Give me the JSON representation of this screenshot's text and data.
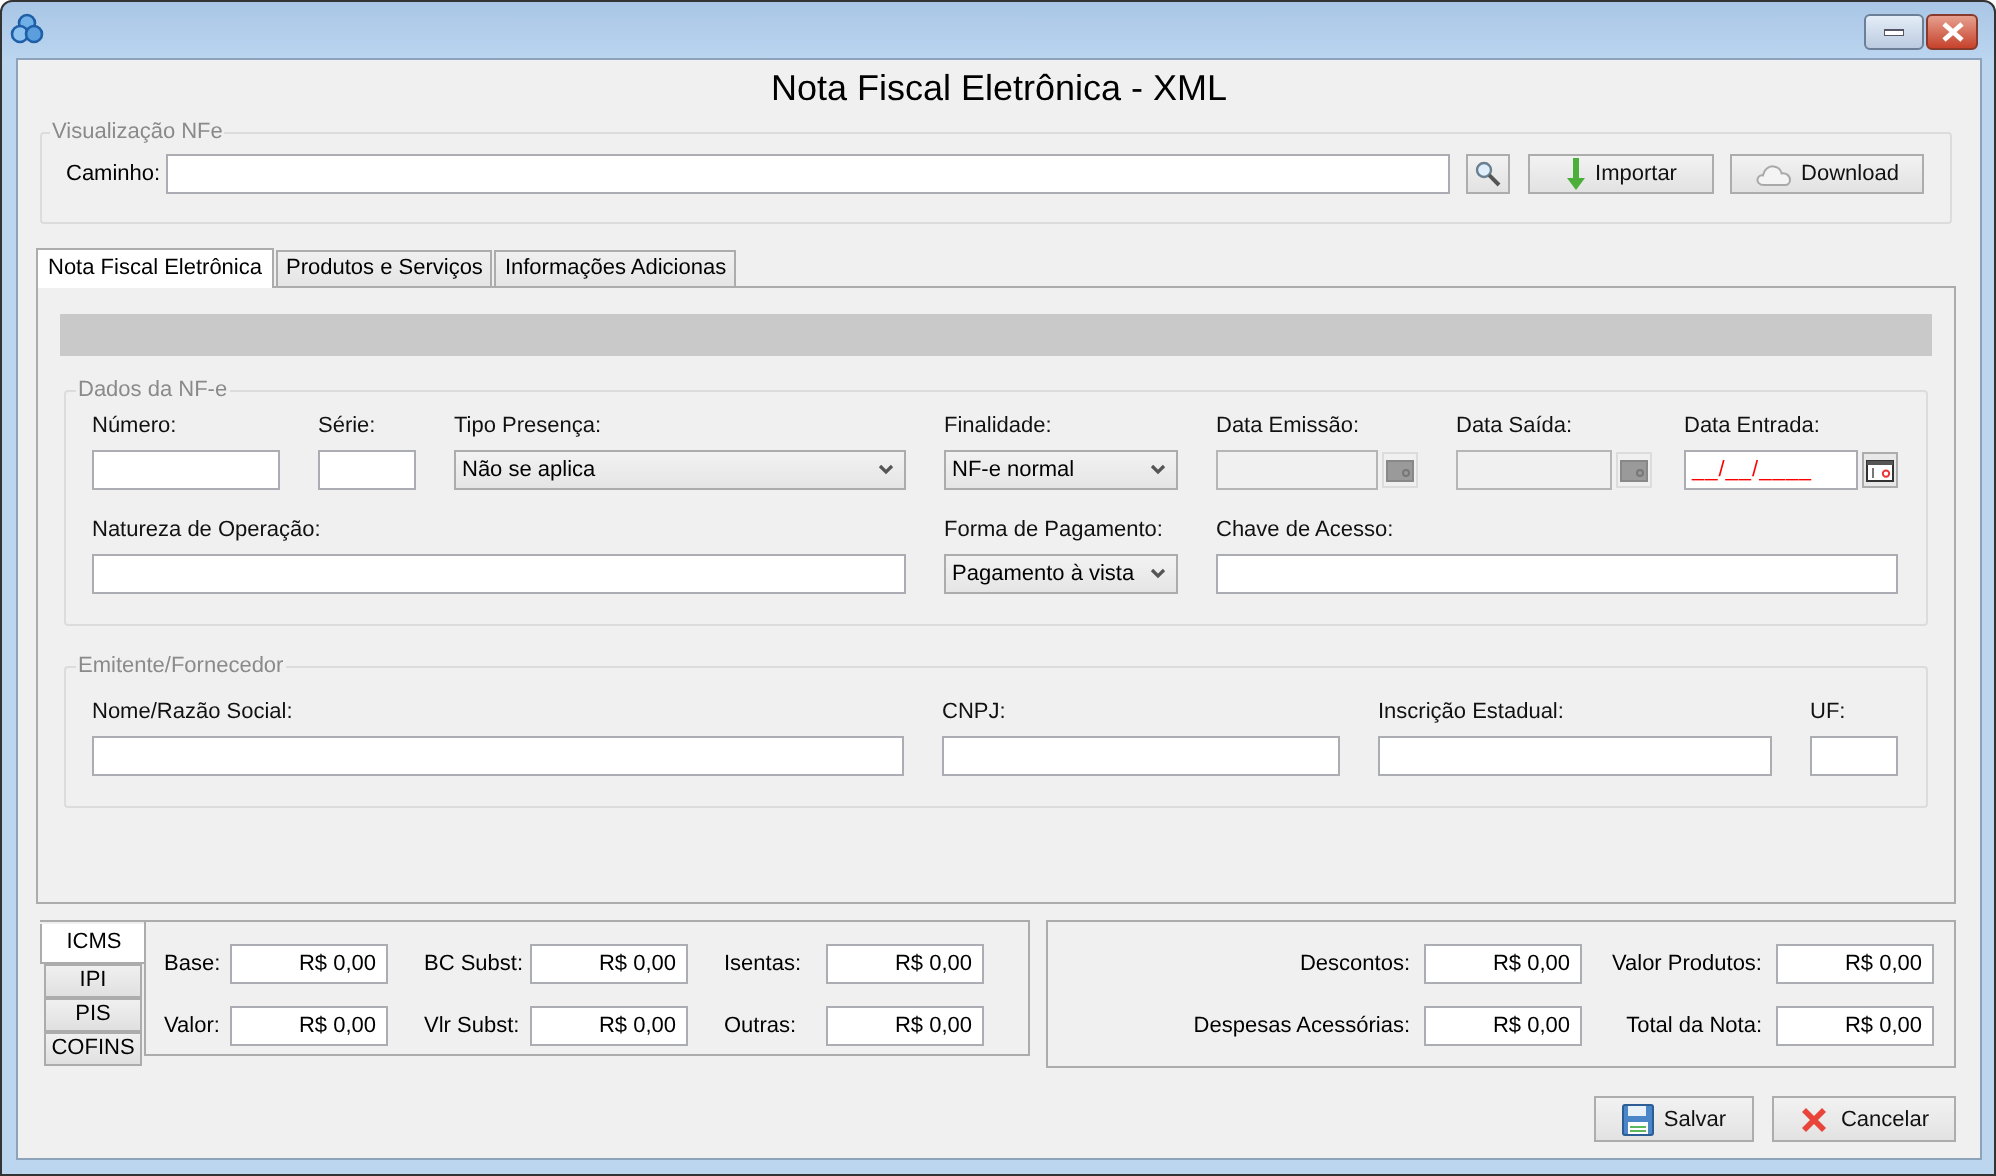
{
  "window": {
    "title": "Nota Fiscal Eletrônica - XML"
  },
  "visualizacao": {
    "legend": "Visualização NFe",
    "path_label": "Caminho:",
    "buttons": [
      {
        "kind": "search"
      },
      {
        "kind": "import",
        "label": "Importar"
      },
      {
        "kind": "download",
        "label": "Download"
      }
    ]
  },
  "tabs": [
    {
      "label": "Nota Fiscal Eletrônica",
      "selected": true
    },
    {
      "label": "Produtos e Serviços",
      "selected": false
    },
    {
      "label": "Informações Adicionas",
      "selected": false
    }
  ],
  "dados_nfe": {
    "legend": "Dados da NF-e",
    "fields": [
      {
        "kind": "text",
        "label": "Número:",
        "disabled": false
      },
      {
        "kind": "text",
        "label": "Série:",
        "disabled": false
      },
      {
        "kind": "select",
        "label": "Tipo Presença:",
        "value": "Não se aplica",
        "disabled": false
      },
      {
        "kind": "select",
        "label": "Finalidade:",
        "value": "NF-e normal",
        "disabled": false
      },
      {
        "kind": "date",
        "label": "Data Emissão:",
        "disabled": true
      },
      {
        "kind": "date",
        "label": "Data Saída:",
        "disabled": true
      },
      {
        "kind": "date",
        "label": "Data Entrada:",
        "value": "__/__/____",
        "disabled": false
      },
      {
        "kind": "text",
        "label": "Natureza de Operação:",
        "disabled": false
      },
      {
        "kind": "select",
        "label": "Forma de Pagamento:",
        "value": "Pagamento à vista",
        "disabled": false
      },
      {
        "kind": "text",
        "label": "Chave de Acesso:",
        "disabled": false
      }
    ]
  },
  "emitente": {
    "legend": "Emitente/Fornecedor",
    "fields": [
      {
        "kind": "text",
        "label": "Nome/Razão Social:"
      },
      {
        "kind": "text",
        "label": "CNPJ:"
      },
      {
        "kind": "text",
        "label": "Inscrição Estadual:"
      },
      {
        "kind": "text",
        "label": "UF:"
      }
    ]
  },
  "impostos": {
    "tabs": [
      {
        "label": "ICMS",
        "selected": true
      },
      {
        "label": "IPI",
        "selected": false
      },
      {
        "label": "PIS",
        "selected": false
      },
      {
        "label": "COFINS",
        "selected": false
      }
    ],
    "fields": [
      {
        "label": "Base:",
        "value": "R$ 0,00"
      },
      {
        "label": "BC Subst:",
        "value": "R$ 0,00"
      },
      {
        "label": "Isentas:",
        "value": "R$ 0,00"
      },
      {
        "label": "Valor:",
        "value": "R$ 0,00"
      },
      {
        "label": "Vlr Subst:",
        "value": "R$ 0,00"
      },
      {
        "label": "Outras:",
        "value": "R$ 0,00"
      }
    ]
  },
  "totais": {
    "fields": [
      {
        "label": "Descontos:",
        "value": "R$ 0,00"
      },
      {
        "label": "Valor Produtos:",
        "value": "R$ 0,00"
      },
      {
        "label": "Despesas Acessórias:",
        "value": "R$ 0,00"
      },
      {
        "label": "Total da Nota:",
        "value": "R$ 0,00"
      }
    ]
  },
  "actions": [
    {
      "kind": "save",
      "label": "Salvar"
    },
    {
      "kind": "cancel",
      "label": "Cancelar"
    }
  ]
}
